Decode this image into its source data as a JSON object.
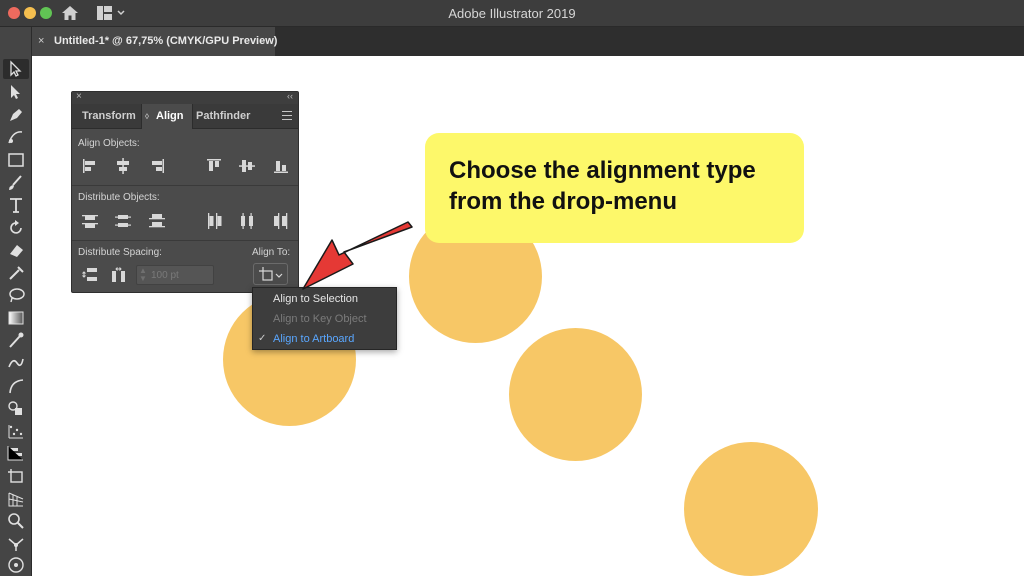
{
  "window": {
    "title": "Adobe Illustrator 2019",
    "traffic_lights": {
      "close": "#ed6a5e",
      "minimize": "#f5bf4f",
      "zoom": "#61c454"
    }
  },
  "document_tab": {
    "close_label": "×",
    "label": "Untitled-1* @ 67,75% (CMYK/GPU Preview)"
  },
  "tools": [
    "selection-tool",
    "direct-selection-tool",
    "pen-tool",
    "curvature-tool",
    "rectangle-tool",
    "paintbrush-tool",
    "type-tool",
    "rotate-tool",
    "eraser-tool",
    "eyedropper-tool",
    "lasso-tool",
    "gradient-tool",
    "eyedropper-tool-2",
    "blend-tool",
    "arc-tool",
    "shape-builder-tool",
    "scatter-tool",
    "bar-graph-tool",
    "artboard-tool",
    "perspective-grid-tool",
    "zoom-tool",
    "direct-selection-tool-2",
    "symbol-sprayer-tool"
  ],
  "align_panel": {
    "close": "×",
    "collapse": "‹‹",
    "tabs": [
      {
        "label": "Transform",
        "active": false
      },
      {
        "label": "Align",
        "active": true
      },
      {
        "label": "Pathfinder",
        "active": false
      }
    ],
    "align_objects_label": "Align Objects:",
    "distribute_objects_label": "Distribute Objects:",
    "distribute_spacing_label": "Distribute Spacing:",
    "align_to_label": "Align To:",
    "spacing_value": "100 pt",
    "align_buttons": [
      "horizontal-align-left",
      "horizontal-align-center",
      "horizontal-align-right",
      "vertical-align-top",
      "vertical-align-center",
      "vertical-align-bottom"
    ],
    "distribute_buttons": [
      "vertical-distribute-top",
      "vertical-distribute-center",
      "vertical-distribute-bottom",
      "horizontal-distribute-left",
      "horizontal-distribute-center",
      "horizontal-distribute-right"
    ]
  },
  "dropdown": {
    "items": [
      {
        "label": "Align to Selection",
        "enabled": true,
        "checked": false,
        "color": "#e6e6e6"
      },
      {
        "label": "Align to Key Object",
        "enabled": false,
        "checked": false,
        "color": "#7b7b7b"
      },
      {
        "label": "Align to Artboard",
        "enabled": true,
        "checked": true,
        "check_mark": "✓",
        "color": "#5aa7ff"
      }
    ]
  },
  "callout": {
    "text": "Choose the alignment type from the drop-menu",
    "background": "#fdf86a"
  },
  "arrow_color": "#e53935",
  "circle_color": "#f7c766"
}
